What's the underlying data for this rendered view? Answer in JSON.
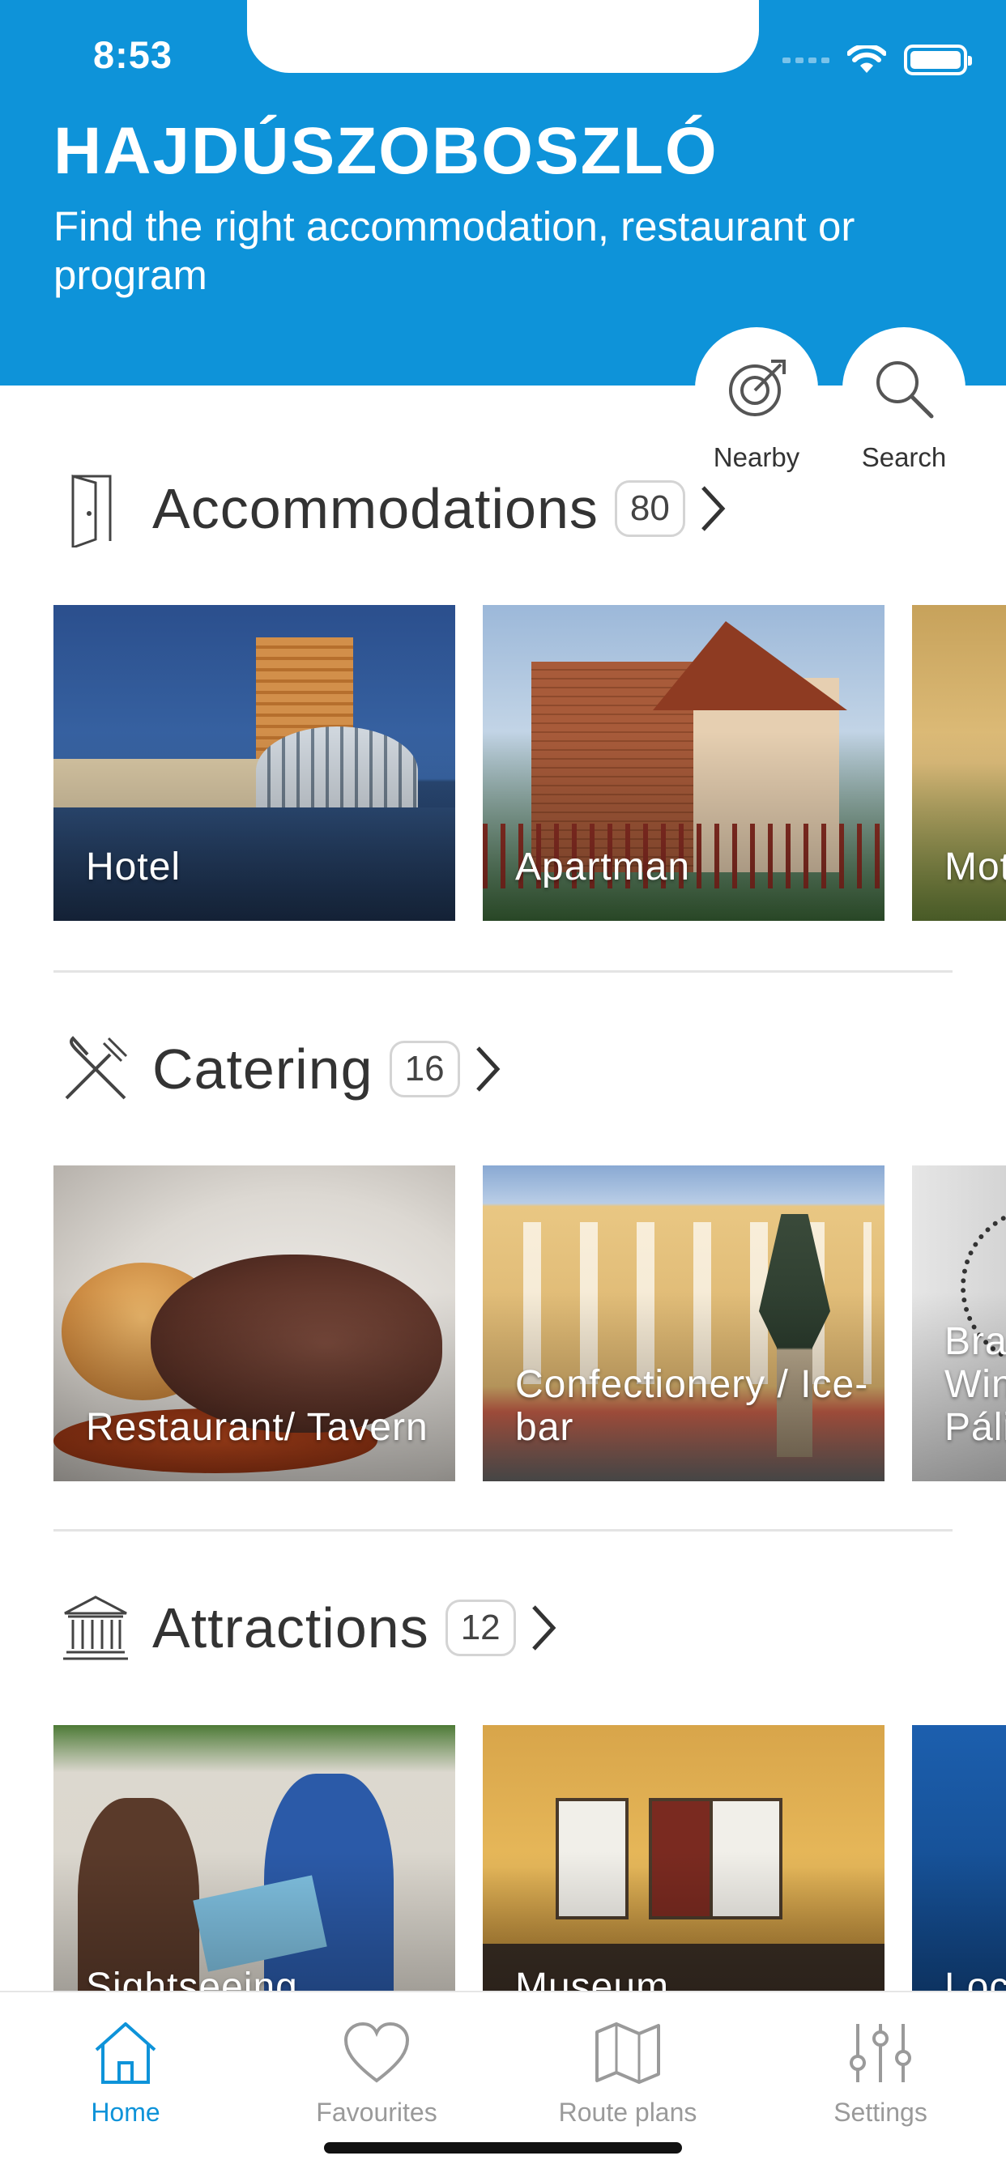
{
  "status_bar": {
    "time": "8:53"
  },
  "header": {
    "city": "HAJDÚSZOBOSZLÓ",
    "tagline": "Find the right accommodation, restaurant or program"
  },
  "quick_actions": {
    "nearby": "Nearby",
    "search": "Search"
  },
  "sections": {
    "accommodations": {
      "title": "Accommodations",
      "count": "80",
      "cards": [
        {
          "label": "Hotel"
        },
        {
          "label": "Apartman"
        },
        {
          "label": "Mot"
        }
      ]
    },
    "catering": {
      "title": "Catering",
      "count": "16",
      "cards": [
        {
          "label": "Restaurant/ Tavern"
        },
        {
          "label": "Confectionery / Ice-bar"
        },
        {
          "label": "Bra Win Páli"
        }
      ]
    },
    "attractions": {
      "title": "Attractions",
      "count": "12",
      "cards": [
        {
          "label": "Sightseeing"
        },
        {
          "label": "Museum"
        },
        {
          "label": "Loc"
        }
      ]
    }
  },
  "tabbar": {
    "home": "Home",
    "favourites": "Favourites",
    "route_plans": "Route plans",
    "settings": "Settings"
  },
  "colors": {
    "brand_blue": "#0e93d9",
    "text_dark": "#333333",
    "tab_inactive": "#9a9a9a"
  },
  "icons": {
    "section_accommodations": "door-icon",
    "section_catering": "fork-knife-icon",
    "section_attractions": "museum-building-icon",
    "nearby": "location-target-icon",
    "search": "search-icon"
  }
}
